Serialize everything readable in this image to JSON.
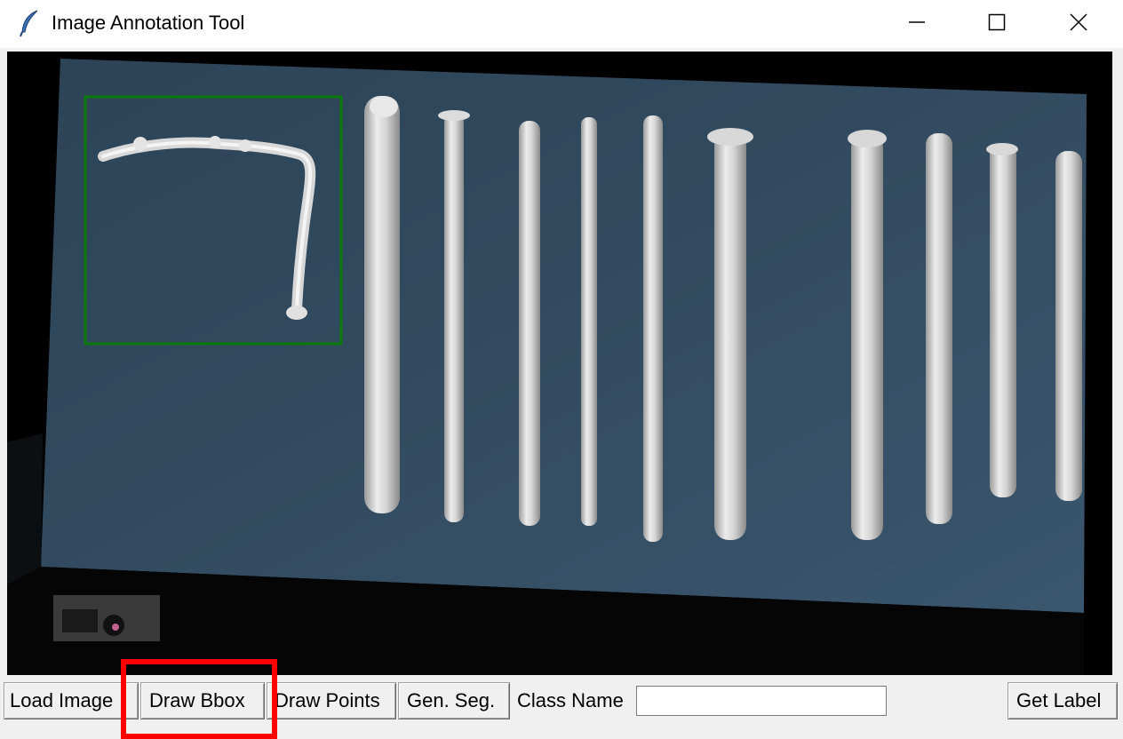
{
  "window": {
    "title": "Image Annotation Tool",
    "icon": "feather-icon"
  },
  "title_controls": {
    "minimize_icon": "minimize-icon",
    "maximize_icon": "maximize-icon",
    "close_icon": "close-icon"
  },
  "canvas": {
    "annotation_box_color": "#0a7a0a",
    "background_color": "#000000",
    "board_color": "#2f4659"
  },
  "toolbar": {
    "load_image_label": "Load Image",
    "draw_bbox_label": "Draw Bbox",
    "draw_points_label": "Draw Points",
    "gen_seg_label": "Gen. Seg.",
    "class_name_label": "Class Name",
    "class_name_value": "",
    "get_label_label": "Get Label"
  },
  "highlight_color": "#ff0000"
}
